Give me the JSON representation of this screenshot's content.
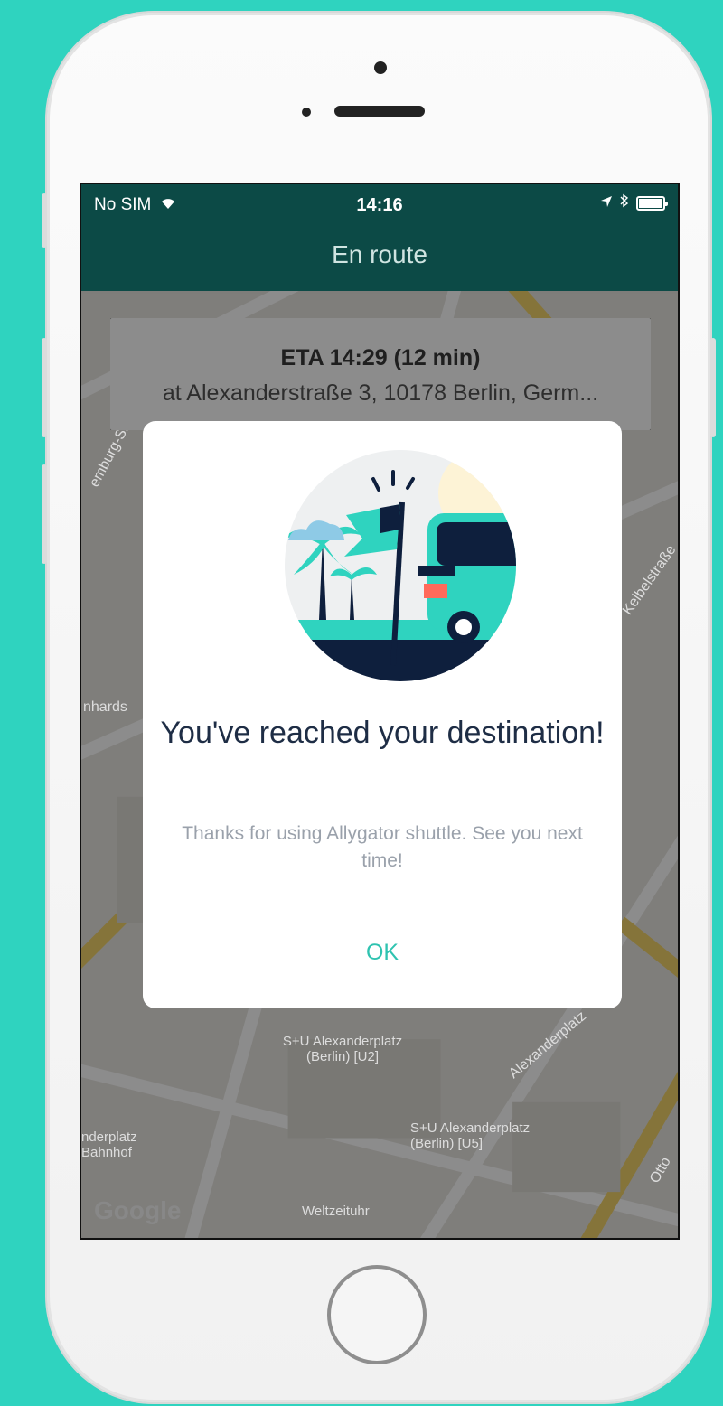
{
  "status_bar": {
    "carrier": "No SIM",
    "time": "14:16"
  },
  "nav": {
    "title": "En route"
  },
  "eta": {
    "title": "ETA 14:29 (12 min)",
    "address": "at Alexanderstraße 3, 10178 Berlin, Germ..."
  },
  "map": {
    "labels": {
      "street_1": "Alexanderplatz",
      "station_u2": "S+U Alexanderplatz (Berlin) [U2]",
      "station_u5": "S+U Alexanderplatz (Berlin) [U5]",
      "bahnhof": "nderplatz Bahnhof",
      "weltzeituhr": "Weltzeituhr",
      "nhards": "nhards",
      "burg": "emburg-Straße",
      "keibel": "Keibelstraße",
      "otto": "Otto",
      "google": "Google"
    }
  },
  "modal": {
    "title": "You've reached your destination!",
    "body": "Thanks for using Allygator shuttle. See you next time!",
    "ok_label": "OK"
  },
  "colors": {
    "background": "#2fd3bf",
    "navbar": "#0c4a46",
    "accent": "#2fc3b0",
    "title": "#1e2d45"
  }
}
